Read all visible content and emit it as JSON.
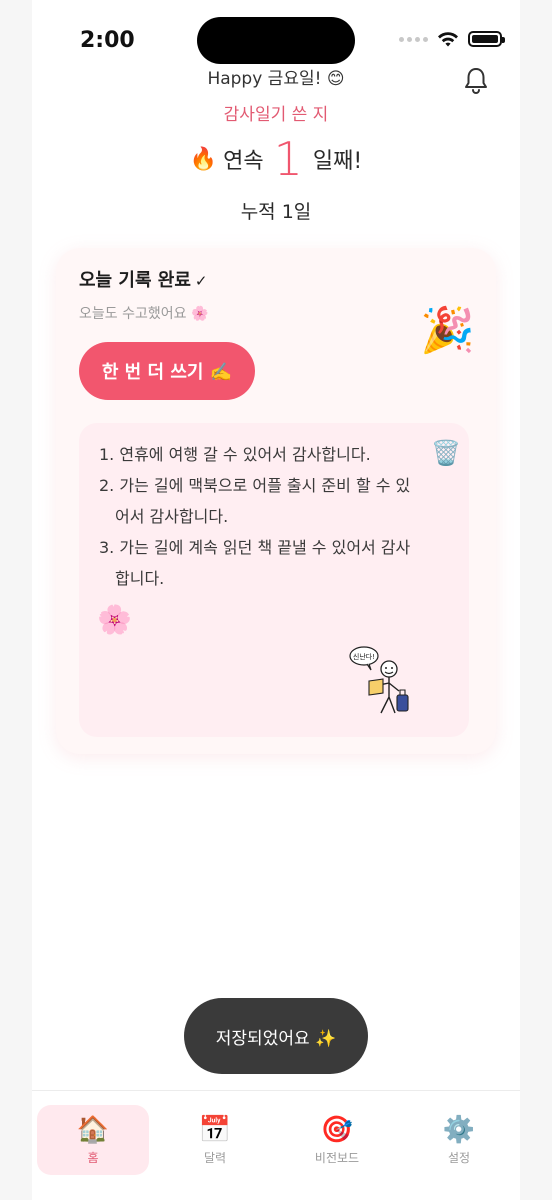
{
  "status_bar": {
    "time": "2:00"
  },
  "header": {
    "greeting": "Happy 금요일! 😊",
    "subtitle": "감사일기 쓴 지",
    "streak_prefix": "연속",
    "streak_count": "1",
    "streak_suffix": "일째!",
    "total": "누적 1일"
  },
  "card": {
    "title": "오늘 기록 완료",
    "title_check": "✓",
    "subtitle": "오늘도 수고했어요 🌸",
    "party_emoji": "🎉",
    "write_again_label": "한 번 더 쓰기 ✍️",
    "entries": [
      "1. 연휴에 여행 갈 수 있어서 감사합니다.",
      "2. 가는 길에 맥북으로 어플 출시 준비 할 수 있어서 감사합니다.",
      "3. 가는 길에 계속 읽던 책 끝낼 수 있어서 감사합니다."
    ],
    "trash_emoji": "🗑️",
    "flower_emoji": "🌸",
    "doodle_text": "신난다!"
  },
  "toast": {
    "text": "저장되었어요 ✨"
  },
  "tabbar": {
    "tabs": [
      {
        "icon": "🏠",
        "label": "홈",
        "active": true
      },
      {
        "icon": "📅",
        "label": "달력",
        "active": false
      },
      {
        "icon": "🎯",
        "label": "비전보드",
        "active": false
      },
      {
        "icon": "⚙️",
        "label": "설정",
        "active": false
      }
    ]
  },
  "colors": {
    "accent": "#f2566e",
    "accent_text": "#e25a72",
    "card_bg": "#fff7f7",
    "entry_bg": "#ffeef2",
    "toast_bg": "#3a3a3a"
  }
}
